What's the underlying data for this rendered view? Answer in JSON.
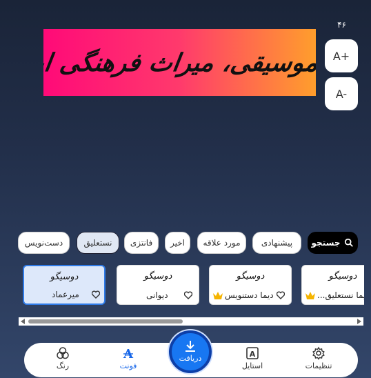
{
  "font_size": {
    "value": "۴۶",
    "plus_label": "A+",
    "minus_label": "A-"
  },
  "preview": {
    "text": "هنر موسیقی، میراث فرهنگی ایران"
  },
  "chips": [
    {
      "label": "جستجو",
      "type": "search"
    },
    {
      "label": "پیشنهادی"
    },
    {
      "label": "مورد علاقه"
    },
    {
      "label": "اخیر"
    },
    {
      "label": "فانتزی"
    },
    {
      "label": "نستعلیق",
      "active": true
    },
    {
      "label": "دست‌نویس"
    }
  ],
  "cards": [
    {
      "sample": "دوسیگو",
      "name": "دیما نستعلیق...",
      "premium": true
    },
    {
      "sample": "دوسیگو",
      "name": "دیما دستنویس",
      "premium": true
    },
    {
      "sample": "دوسیگو",
      "name": "دیوانی",
      "premium": false
    },
    {
      "sample": "دوسیگو",
      "name": "میرعماد",
      "premium": false,
      "selected": true
    }
  ],
  "scroll_position": 0.45,
  "nav": {
    "settings": "تنظیمات",
    "style": "استایل",
    "download": "دریافت",
    "font": "فونت",
    "color": "رنگ"
  },
  "colors": {
    "accent": "#1877f2",
    "active_nav": "#1565e8",
    "premium": "#f5b400"
  }
}
